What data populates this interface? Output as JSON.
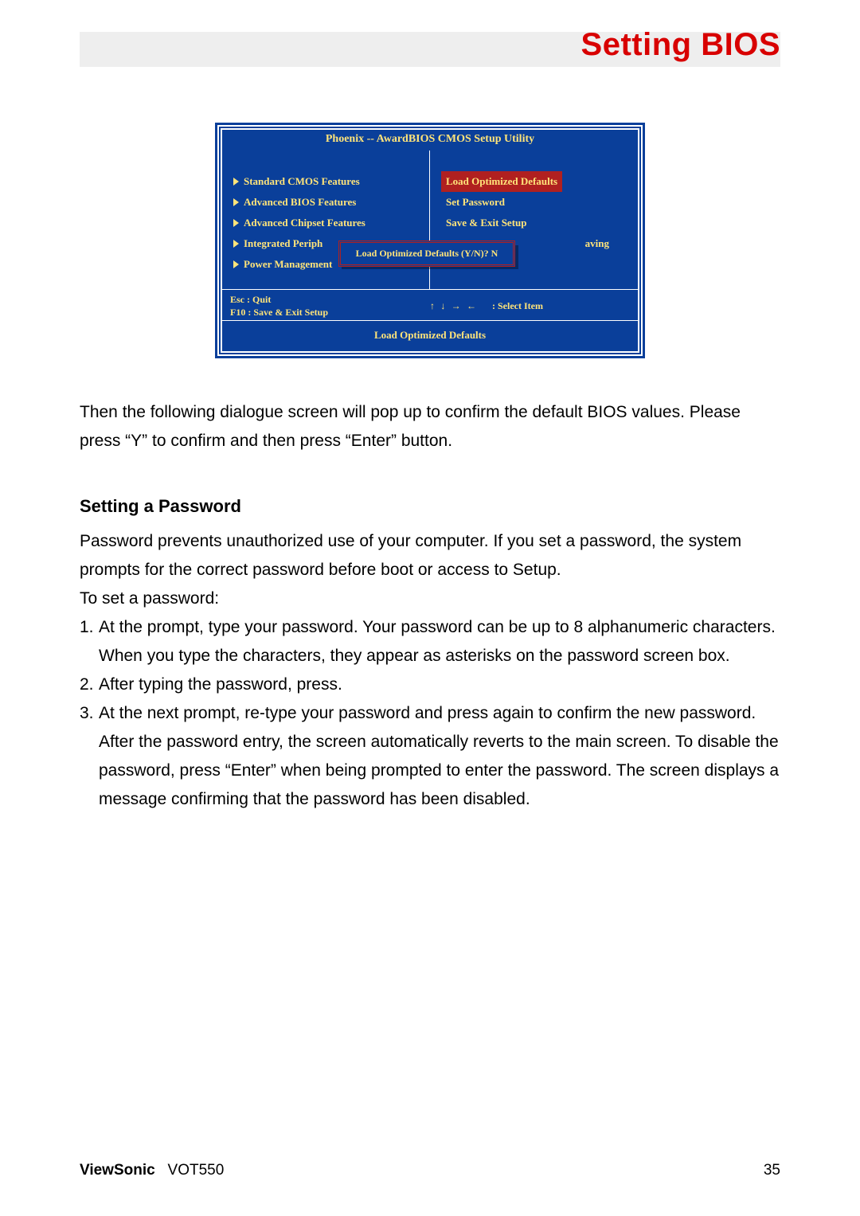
{
  "header": {
    "title": "Setting BIOS"
  },
  "bios": {
    "title": "Phoenix  --  AwardBIOS CMOS Setup Utility",
    "left_items": [
      "Standard  CMOS  Features",
      "Advanced  BIOS  Features",
      "Advanced  Chipset  Features",
      "Integrated  Periph",
      "Power  Management"
    ],
    "right_items": [
      "Load  Optimized  Defaults",
      "Set  Password",
      "Save  &  Exit  Setup",
      "aving"
    ],
    "right_partial_suffix": "aving",
    "dialog": "Load  Optimized  Defaults  (Y/N)?  N",
    "hint_left_1": "Esc  :  Quit",
    "hint_left_2": "F10  :  Save  &  Exit  Setup",
    "hint_right": ":  Select  Item",
    "arrows": "↑ ↓ → ←",
    "footer": "Load Optimized  Defaults"
  },
  "body": {
    "p1": "Then the following dialogue screen will pop up to confirm the default BIOS values. Please press “Y” to confirm and then press “Enter” button.",
    "section_title": "Setting a Password",
    "p2": "Password prevents unauthorized use of your computer. If you set a password, the system prompts for the correct password before boot or access to Setup.",
    "p3": "To set a password:",
    "steps": [
      "At the prompt, type your password. Your password can be up to 8 alphanumeric characters. When you type the characters, they appear as asterisks on the password screen box.",
      "After typing the password, press.",
      "At the next prompt, re-type your password and press again to confirm the new password. After the password entry, the screen automatically reverts to the main screen. To disable the password, press “Enter” when being prompted to enter the password. The screen displays a message confirming that the password has been disabled."
    ]
  },
  "footer": {
    "brand": "ViewSonic",
    "model": "VOT550",
    "page": "35"
  }
}
